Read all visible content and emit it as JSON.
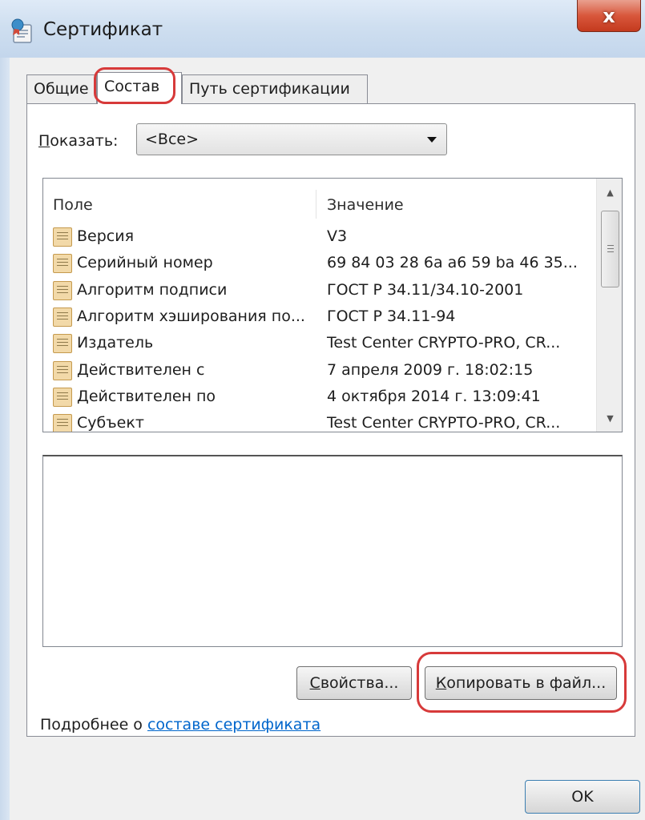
{
  "window": {
    "title": "Сертификат",
    "close_label": "x"
  },
  "tabs": [
    {
      "label": "Общие",
      "active": false
    },
    {
      "label": "Состав",
      "active": true
    },
    {
      "label": "Путь сертификации",
      "active": false
    }
  ],
  "show": {
    "label_accel": "П",
    "label_rest": "оказать:",
    "selected": "<Все>"
  },
  "list": {
    "headers": {
      "field": "Поле",
      "value": "Значение"
    },
    "rows": [
      {
        "field": "Версия",
        "value": "V3"
      },
      {
        "field": "Серийный номер",
        "value": "69 84 03 28 6a a6 59 ba 46 35..."
      },
      {
        "field": "Алгоритм подписи",
        "value": "ГОСТ Р 34.11/34.10-2001"
      },
      {
        "field": "Алгоритм хэширования по...",
        "value": "ГОСТ Р 34.11-94"
      },
      {
        "field": "Издатель",
        "value": "Test Center CRYPTO-PRO, CR..."
      },
      {
        "field": "Действителен с",
        "value": "7 апреля 2009 г. 18:02:15"
      },
      {
        "field": "Действителен по",
        "value": "4 октября 2014 г. 13:09:41"
      },
      {
        "field": "Субъект",
        "value": "Test Center CRYPTO-PRO, CR..."
      }
    ],
    "row_icon": "document-field-icon"
  },
  "buttons": {
    "properties_accel": "С",
    "properties_rest": "войства...",
    "copy_accel": "К",
    "copy_rest": "опировать в файл...",
    "ok": "OK"
  },
  "footer": {
    "more_prefix": "Подробнее о ",
    "more_link": "составе сертификата"
  },
  "colors": {
    "highlight": "#d73a3a",
    "link": "#0066cc",
    "close_button": "#d8573c"
  }
}
